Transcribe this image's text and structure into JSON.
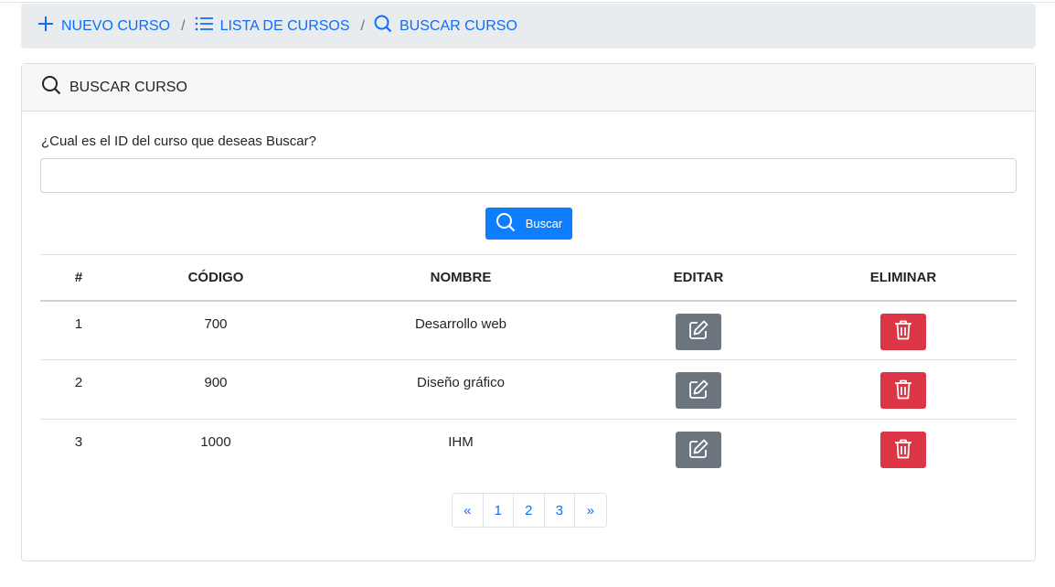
{
  "breadcrumb": {
    "items": [
      {
        "label": "NUEVO CURSO",
        "icon": "plus-icon"
      },
      {
        "label": "LISTA DE CURSOS",
        "icon": "list-icon"
      },
      {
        "label": "BUSCAR CURSO",
        "icon": "search-icon"
      }
    ],
    "separator": "/"
  },
  "card": {
    "title": "BUSCAR CURSO",
    "search_label": "¿Cual es el ID del curso que deseas Buscar?",
    "search_value": "",
    "search_button": "Buscar"
  },
  "table": {
    "headers": [
      "#",
      "CÓDIGO",
      "NOMBRE",
      "EDITAR",
      "ELIMINAR"
    ],
    "rows": [
      {
        "num": "1",
        "codigo": "700",
        "nombre": "Desarrollo web"
      },
      {
        "num": "2",
        "codigo": "900",
        "nombre": "Diseño gráfico"
      },
      {
        "num": "3",
        "codigo": "1000",
        "nombre": "IHM"
      }
    ]
  },
  "pagination": {
    "prev": "«",
    "pages": [
      "1",
      "2",
      "3"
    ],
    "next": "»"
  },
  "colors": {
    "primary": "#0d6efd",
    "secondary": "#6c757d",
    "danger": "#dc3545"
  }
}
